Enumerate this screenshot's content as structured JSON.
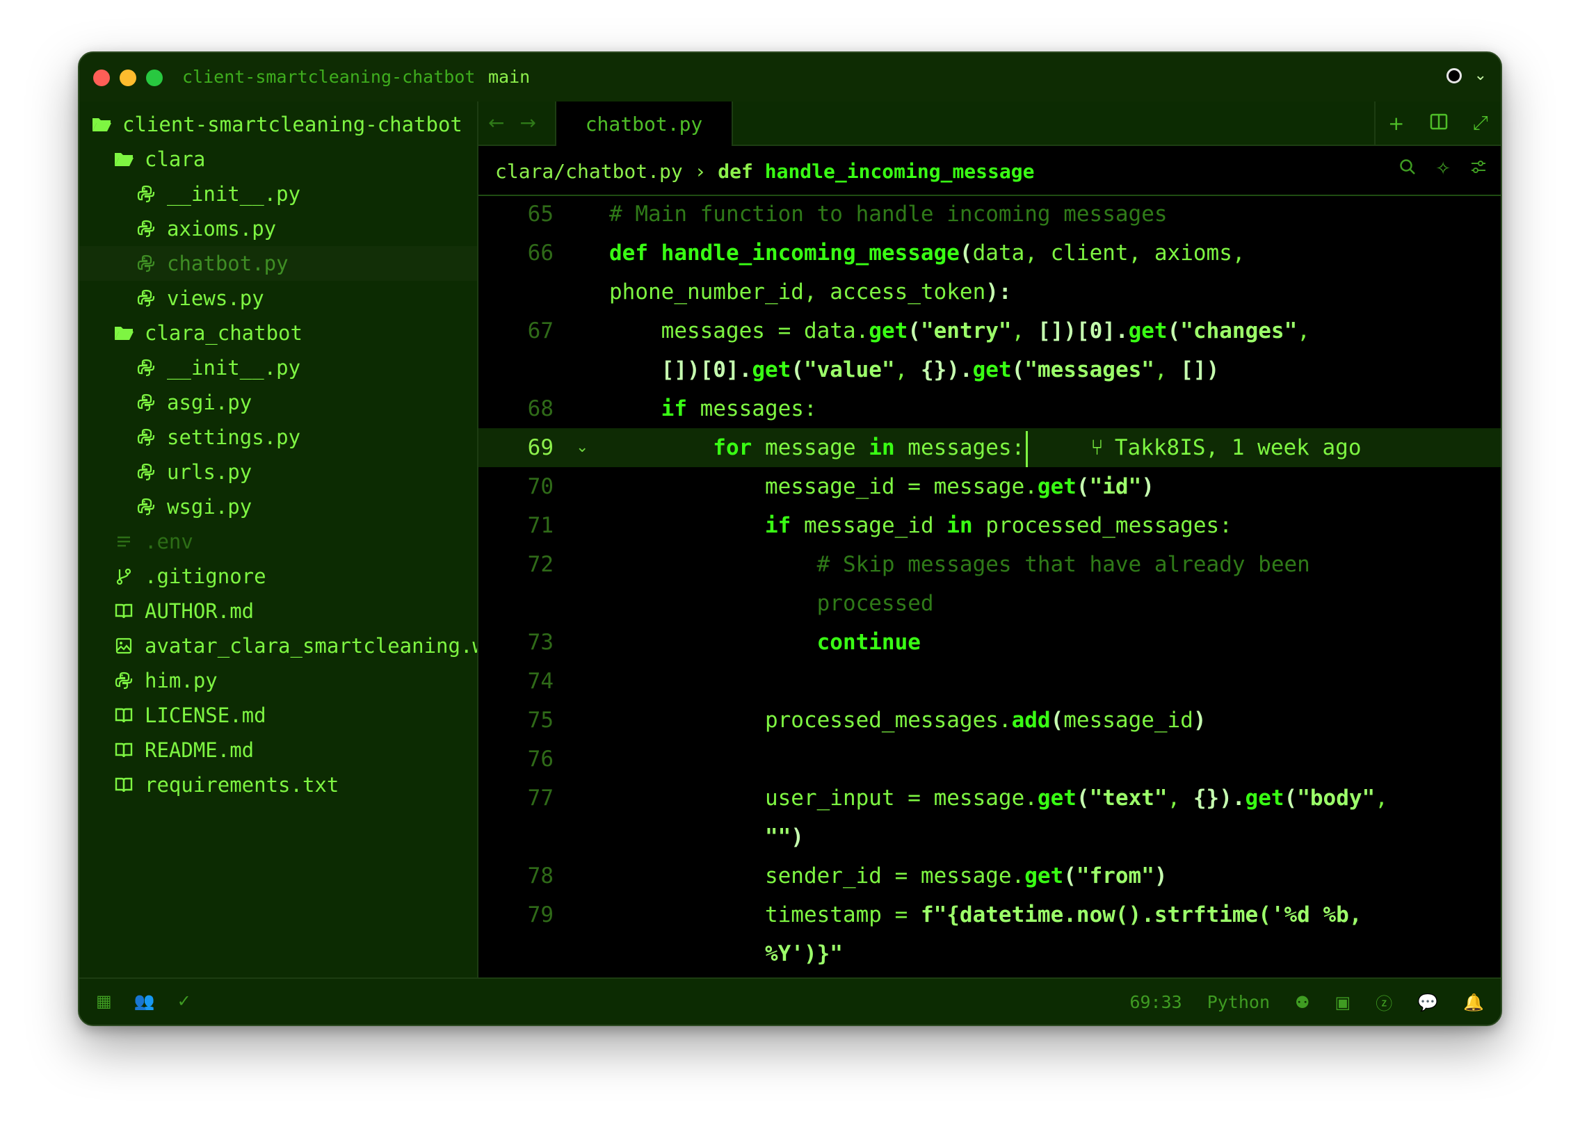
{
  "titlebar": {
    "project": "client-smartcleaning-chatbot",
    "branch": "main"
  },
  "sidebar": {
    "items": [
      {
        "label": "client-smartcleaning-chatbot",
        "icon": "folder-open-icon",
        "depth": 0
      },
      {
        "label": "clara",
        "icon": "folder-open-icon",
        "depth": 1
      },
      {
        "label": "__init__.py",
        "icon": "python-icon",
        "depth": 2
      },
      {
        "label": "axioms.py",
        "icon": "python-icon",
        "depth": 2
      },
      {
        "label": "chatbot.py",
        "icon": "python-icon",
        "depth": 2,
        "state": "selected"
      },
      {
        "label": "views.py",
        "icon": "python-icon",
        "depth": 2
      },
      {
        "label": "clara_chatbot",
        "icon": "folder-open-icon",
        "depth": 1
      },
      {
        "label": "__init__.py",
        "icon": "python-icon",
        "depth": 2
      },
      {
        "label": "asgi.py",
        "icon": "python-icon",
        "depth": 2
      },
      {
        "label": "settings.py",
        "icon": "python-icon",
        "depth": 2
      },
      {
        "label": "urls.py",
        "icon": "python-icon",
        "depth": 2
      },
      {
        "label": "wsgi.py",
        "icon": "python-icon",
        "depth": 2
      },
      {
        "label": ".env",
        "icon": "lines-icon",
        "depth": 1,
        "state": "dim"
      },
      {
        "label": ".gitignore",
        "icon": "git-branch-icon",
        "depth": 1
      },
      {
        "label": "AUTHOR.md",
        "icon": "book-icon",
        "depth": 1
      },
      {
        "label": "avatar_clara_smartcleaning.webp",
        "icon": "image-icon",
        "depth": 1
      },
      {
        "label": "him.py",
        "icon": "python-icon",
        "depth": 1
      },
      {
        "label": "LICENSE.md",
        "icon": "book-icon",
        "depth": 1
      },
      {
        "label": "README.md",
        "icon": "book-icon",
        "depth": 1
      },
      {
        "label": "requirements.txt",
        "icon": "book-icon",
        "depth": 1
      }
    ]
  },
  "tab": {
    "label": "chatbot.py"
  },
  "breadcrumb": {
    "path": "clara/chatbot.py",
    "separator": "›",
    "keyword": "def",
    "function": "handle_incoming_message"
  },
  "blame": {
    "author": "Takk8IS",
    "when": "1 week ago"
  },
  "code_lines": [
    {
      "number": "65",
      "tokens": [
        [
          "c",
          "# Main function to handle incoming messages"
        ]
      ]
    },
    {
      "number": "66",
      "tokens": [
        [
          "k",
          "def "
        ],
        [
          "f",
          "handle_incoming_message"
        ],
        [
          "p",
          "("
        ],
        [
          "t",
          "data, client, axioms,"
        ]
      ]
    },
    {
      "number": "",
      "tokens": [
        [
          "t",
          "phone_number_id, access_token"
        ],
        [
          "p",
          "):"
        ]
      ]
    },
    {
      "number": "67",
      "tokens": [
        [
          "t",
          "    messages = data."
        ],
        [
          "f",
          "get"
        ],
        [
          "p",
          "("
        ],
        [
          "s",
          "\"entry\""
        ],
        [
          "t",
          ", "
        ],
        [
          "p",
          "[])[0]."
        ],
        [
          "f",
          "get"
        ],
        [
          "p",
          "("
        ],
        [
          "s",
          "\"changes\""
        ],
        [
          "t",
          ","
        ]
      ]
    },
    {
      "number": "",
      "tokens": [
        [
          "p",
          "    [])[0]."
        ],
        [
          "f",
          "get"
        ],
        [
          "p",
          "("
        ],
        [
          "s",
          "\"value\""
        ],
        [
          "t",
          ", "
        ],
        [
          "p",
          "{})."
        ],
        [
          "f",
          "get"
        ],
        [
          "p",
          "("
        ],
        [
          "s",
          "\"messages\""
        ],
        [
          "t",
          ", "
        ],
        [
          "p",
          "[])"
        ]
      ]
    },
    {
      "number": "68",
      "tokens": [
        [
          "k",
          "    if "
        ],
        [
          "t",
          "messages:"
        ]
      ]
    },
    {
      "number": "69",
      "highlight": true,
      "fold": "⌄",
      "tokens": [
        [
          "k",
          "        for "
        ],
        [
          "t",
          "message "
        ],
        [
          "k",
          "in "
        ],
        [
          "t",
          "messages:"
        ]
      ]
    },
    {
      "number": "70",
      "tokens": [
        [
          "t",
          "            message_id = message."
        ],
        [
          "f",
          "get"
        ],
        [
          "p",
          "("
        ],
        [
          "s",
          "\"id\""
        ],
        [
          "p",
          ")"
        ]
      ]
    },
    {
      "number": "71",
      "tokens": [
        [
          "k",
          "            if "
        ],
        [
          "t",
          "message_id "
        ],
        [
          "k",
          "in "
        ],
        [
          "t",
          "processed_messages:"
        ]
      ]
    },
    {
      "number": "72",
      "tokens": [
        [
          "c",
          "                # Skip messages that have already been"
        ]
      ]
    },
    {
      "number": "",
      "tokens": [
        [
          "c",
          "                processed"
        ]
      ]
    },
    {
      "number": "73",
      "tokens": [
        [
          "k",
          "                continue"
        ]
      ]
    },
    {
      "number": "74",
      "tokens": []
    },
    {
      "number": "75",
      "tokens": [
        [
          "t",
          "            processed_messages."
        ],
        [
          "f",
          "add"
        ],
        [
          "p",
          "("
        ],
        [
          "t",
          "message_id"
        ],
        [
          "p",
          ")"
        ]
      ]
    },
    {
      "number": "76",
      "tokens": []
    },
    {
      "number": "77",
      "tokens": [
        [
          "t",
          "            user_input = message."
        ],
        [
          "f",
          "get"
        ],
        [
          "p",
          "("
        ],
        [
          "s",
          "\"text\""
        ],
        [
          "t",
          ", "
        ],
        [
          "p",
          "{})."
        ],
        [
          "f",
          "get"
        ],
        [
          "p",
          "("
        ],
        [
          "s",
          "\"body\""
        ],
        [
          "t",
          ","
        ]
      ]
    },
    {
      "number": "",
      "tokens": [
        [
          "s",
          "            \"\""
        ],
        [
          "p",
          ")"
        ]
      ]
    },
    {
      "number": "78",
      "tokens": [
        [
          "t",
          "            sender_id = message."
        ],
        [
          "f",
          "get"
        ],
        [
          "p",
          "("
        ],
        [
          "s",
          "\"from\""
        ],
        [
          "p",
          ")"
        ]
      ]
    },
    {
      "number": "79",
      "tokens": [
        [
          "t",
          "            timestamp = "
        ],
        [
          "s",
          "f\"{datetime.now().strftime('%d %b,"
        ]
      ]
    },
    {
      "number": "",
      "tokens": [
        [
          "s",
          "            %Y')}\""
        ]
      ]
    }
  ],
  "statusbar": {
    "position": "69:33",
    "language": "Python"
  },
  "colors": {
    "background": "#0c2b02",
    "editor_bg": "#000000",
    "accent": "#39ff14",
    "text": "#7ef542",
    "comment": "#2f7a18"
  }
}
